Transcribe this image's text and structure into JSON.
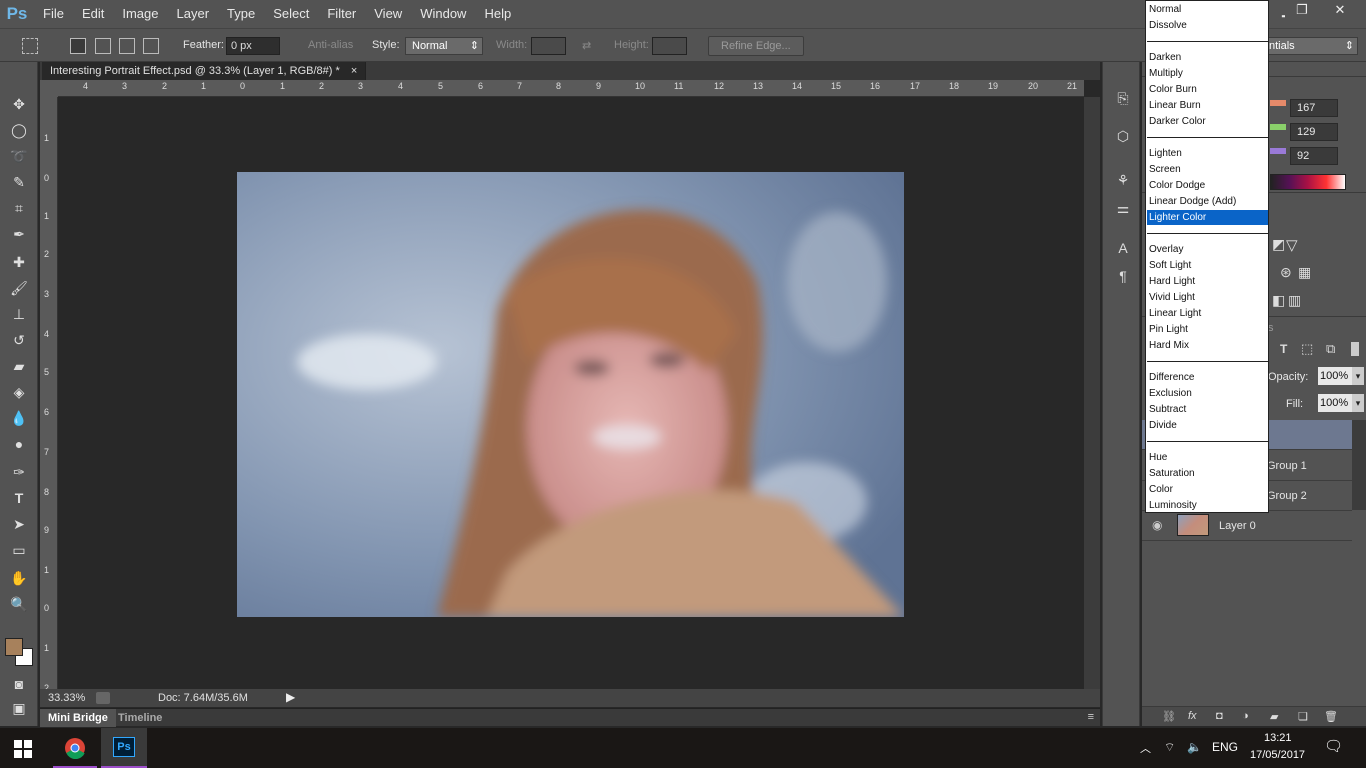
{
  "app": {
    "logo": "Ps"
  },
  "menubar": {
    "items": [
      "File",
      "Edit",
      "Image",
      "Layer",
      "Type",
      "Select",
      "Filter",
      "View",
      "Window",
      "Help"
    ]
  },
  "window_controls": {
    "minimize": "▁",
    "restore": "❐",
    "close": "✕"
  },
  "options": {
    "feather_label": "Feather:",
    "feather_value": "0 px",
    "antialias_label": "Anti-alias",
    "style_label": "Style:",
    "style_value": "Normal",
    "width_label": "Width:",
    "height_label": "Height:",
    "refine_edge": "Refine Edge...",
    "workspace": "ntials"
  },
  "document": {
    "tab_title": "Interesting Portrait Effect.psd @ 33.3% (Layer 1, RGB/8#) *",
    "close": "×",
    "zoom": "33.33%",
    "doc_size": "Doc: 7.64M/35.6M"
  },
  "ruler": {
    "top": [
      "4",
      "3",
      "2",
      "1",
      "0",
      "1",
      "2",
      "3",
      "4",
      "5",
      "6",
      "7",
      "8",
      "9",
      "10",
      "11",
      "12",
      "13",
      "14",
      "15",
      "16",
      "17",
      "18",
      "19",
      "20",
      "21"
    ],
    "left": [
      "1",
      "0",
      "1",
      "2",
      "3",
      "4",
      "5",
      "6",
      "7",
      "8",
      "9",
      "1",
      "0",
      "1",
      "2"
    ]
  },
  "bottom_tabs": {
    "mini_bridge": "Mini Bridge",
    "timeline": "Timeline"
  },
  "color_panel": {
    "r": "167",
    "g": "129",
    "b": "92"
  },
  "layers_panel": {
    "opacity_label": "Opacity:",
    "opacity_value": "100%",
    "fill_label": "Fill:",
    "fill_value": "100%",
    "tab_partial": "s",
    "layers": [
      {
        "name": ""
      },
      {
        "name": "Group 1"
      },
      {
        "name": "Group 2"
      },
      {
        "name": "Layer 0"
      }
    ]
  },
  "blend_modes": {
    "selected": "Lighter Color",
    "groups": [
      [
        "Normal",
        "Dissolve"
      ],
      [
        "Darken",
        "Multiply",
        "Color Burn",
        "Linear Burn",
        "Darker Color"
      ],
      [
        "Lighten",
        "Screen",
        "Color Dodge",
        "Linear Dodge (Add)",
        "Lighter Color"
      ],
      [
        "Overlay",
        "Soft Light",
        "Hard Light",
        "Vivid Light",
        "Linear Light",
        "Pin Light",
        "Hard Mix"
      ],
      [
        "Difference",
        "Exclusion",
        "Subtract",
        "Divide"
      ],
      [
        "Hue",
        "Saturation",
        "Color",
        "Luminosity"
      ]
    ]
  },
  "taskbar": {
    "lang": "ENG",
    "time": "13:21",
    "date": "17/05/2017",
    "ps_label": "Ps"
  },
  "colors": {
    "foreground": "#a7815c",
    "background": "#ffffff",
    "accent": "#0a64c8"
  }
}
